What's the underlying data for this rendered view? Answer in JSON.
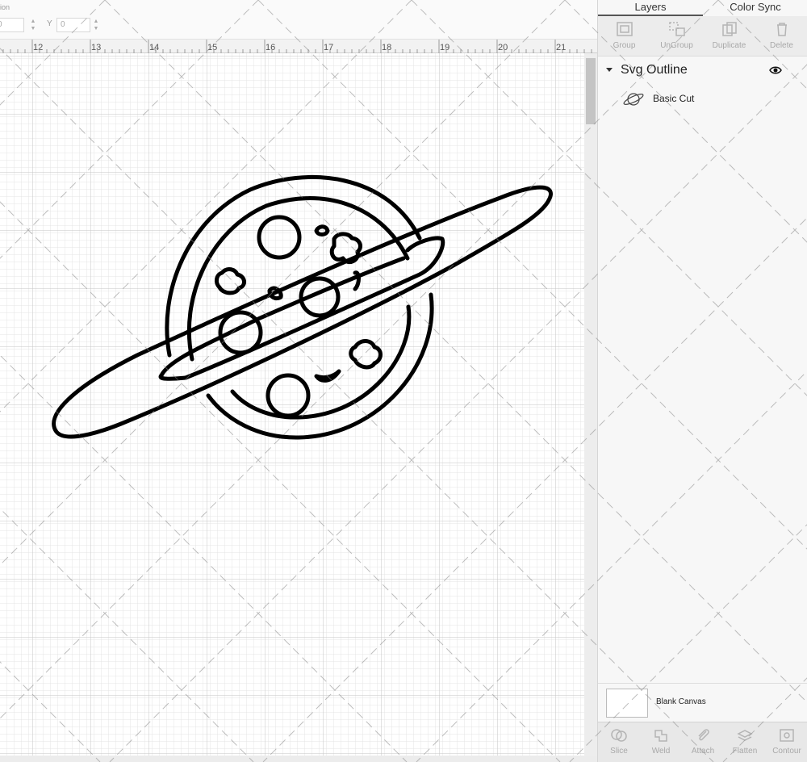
{
  "properties": {
    "label": "ion",
    "w_value": "0",
    "y_axis": "Y",
    "y_value": "0"
  },
  "ruler": {
    "ticks": [
      "12",
      "13",
      "14",
      "15",
      "16",
      "17",
      "18",
      "19",
      "20",
      "21"
    ]
  },
  "panel": {
    "tabs": [
      {
        "label": "Layers"
      },
      {
        "label": "Color Sync"
      }
    ],
    "toolbar": [
      {
        "label": "Group",
        "icon": "group-icon"
      },
      {
        "label": "UnGroup",
        "icon": "ungroup-icon"
      },
      {
        "label": "Duplicate",
        "icon": "duplicate-icon"
      },
      {
        "label": "Delete",
        "icon": "delete-icon"
      }
    ],
    "layer_group": {
      "title": "Svg Outline",
      "visibility_icon": "eye-icon"
    },
    "layer_item": {
      "name": "Basic Cut",
      "thumb_icon": "planet-thumbnail-icon"
    },
    "blank_canvas": {
      "label": "Blank Canvas"
    },
    "bottom_tools": [
      {
        "label": "Slice",
        "icon": "slice-icon"
      },
      {
        "label": "Weld",
        "icon": "weld-icon"
      },
      {
        "label": "Attach",
        "icon": "attach-icon"
      },
      {
        "label": "Flatten",
        "icon": "flatten-icon"
      },
      {
        "label": "Contour",
        "icon": "contour-icon"
      }
    ]
  },
  "colors": {
    "grid_minor": "#e4e4e4",
    "grid_major": "#c6c6c6",
    "outline": "#000000",
    "panel_bg": "#f7f7f7"
  }
}
